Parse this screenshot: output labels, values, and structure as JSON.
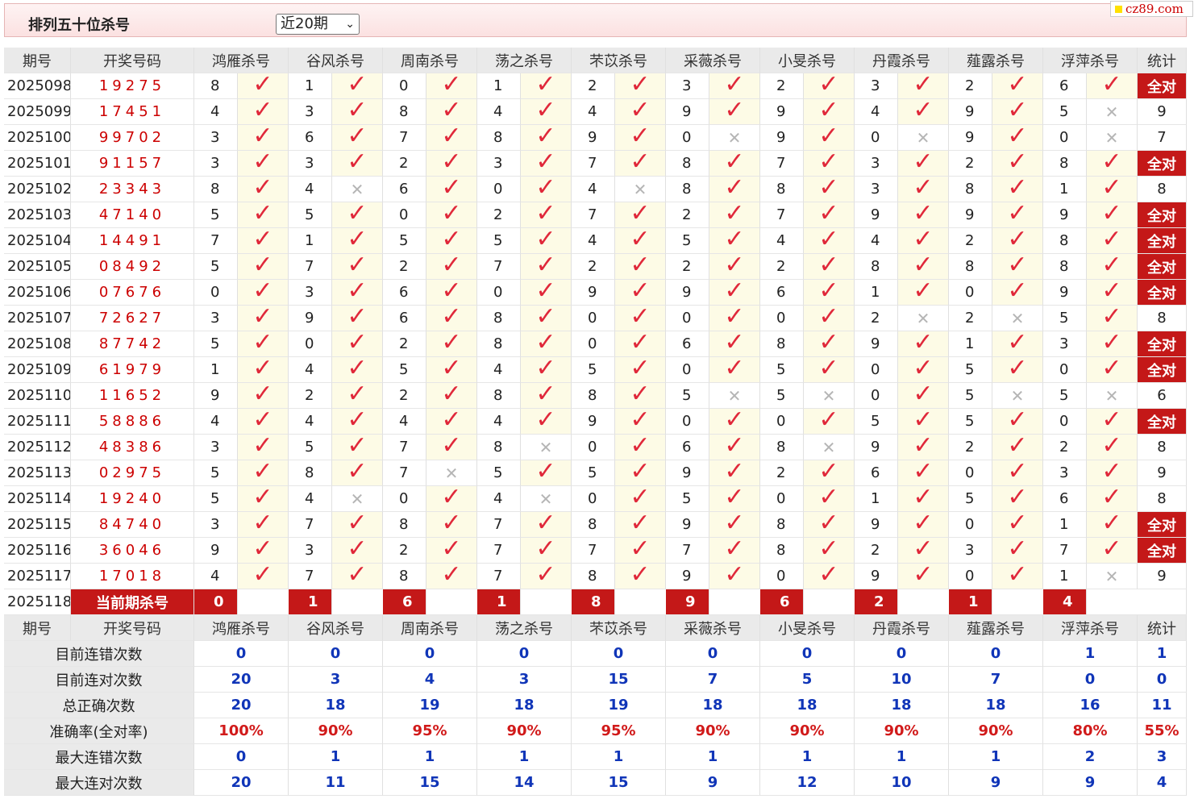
{
  "header": {
    "title": "排列五十位杀号",
    "period_select": "近20期",
    "logo_text": "cz89.com"
  },
  "columns": [
    "期号",
    "开奖号码",
    "鸿雁杀号",
    "谷风杀号",
    "周南杀号",
    "荡之杀号",
    "芣苡杀号",
    "采薇杀号",
    "小旻杀号",
    "丹霞杀号",
    "薤露杀号",
    "浮萍杀号",
    "统计"
  ],
  "rows": [
    {
      "issue": "2025098",
      "draw": "19275",
      "k": [
        "8",
        "1",
        "0",
        "1",
        "2",
        "3",
        "2",
        "3",
        "2",
        "6"
      ],
      "ok": [
        1,
        1,
        1,
        1,
        1,
        1,
        1,
        1,
        1,
        1
      ],
      "stat": "全对"
    },
    {
      "issue": "2025099",
      "draw": "17451",
      "k": [
        "4",
        "3",
        "8",
        "4",
        "4",
        "9",
        "9",
        "4",
        "9",
        "5"
      ],
      "ok": [
        1,
        1,
        1,
        1,
        1,
        1,
        1,
        1,
        1,
        0
      ],
      "stat": "9"
    },
    {
      "issue": "2025100",
      "draw": "99702",
      "k": [
        "3",
        "6",
        "7",
        "8",
        "9",
        "0",
        "9",
        "0",
        "9",
        "0"
      ],
      "ok": [
        1,
        1,
        1,
        1,
        1,
        0,
        1,
        0,
        1,
        0
      ],
      "stat": "7"
    },
    {
      "issue": "2025101",
      "draw": "91157",
      "k": [
        "3",
        "3",
        "2",
        "3",
        "7",
        "8",
        "7",
        "3",
        "2",
        "8"
      ],
      "ok": [
        1,
        1,
        1,
        1,
        1,
        1,
        1,
        1,
        1,
        1
      ],
      "stat": "全对"
    },
    {
      "issue": "2025102",
      "draw": "23343",
      "k": [
        "8",
        "4",
        "6",
        "0",
        "4",
        "8",
        "8",
        "3",
        "8",
        "1"
      ],
      "ok": [
        1,
        0,
        1,
        1,
        0,
        1,
        1,
        1,
        1,
        1
      ],
      "stat": "8"
    },
    {
      "issue": "2025103",
      "draw": "47140",
      "k": [
        "5",
        "5",
        "0",
        "2",
        "7",
        "2",
        "7",
        "9",
        "9",
        "9"
      ],
      "ok": [
        1,
        1,
        1,
        1,
        1,
        1,
        1,
        1,
        1,
        1
      ],
      "stat": "全对"
    },
    {
      "issue": "2025104",
      "draw": "14491",
      "k": [
        "7",
        "1",
        "5",
        "5",
        "4",
        "5",
        "4",
        "4",
        "2",
        "8"
      ],
      "ok": [
        1,
        1,
        1,
        1,
        1,
        1,
        1,
        1,
        1,
        1
      ],
      "stat": "全对"
    },
    {
      "issue": "2025105",
      "draw": "08492",
      "k": [
        "5",
        "7",
        "2",
        "7",
        "2",
        "2",
        "2",
        "8",
        "8",
        "8"
      ],
      "ok": [
        1,
        1,
        1,
        1,
        1,
        1,
        1,
        1,
        1,
        1
      ],
      "stat": "全对"
    },
    {
      "issue": "2025106",
      "draw": "07676",
      "k": [
        "0",
        "3",
        "6",
        "0",
        "9",
        "9",
        "6",
        "1",
        "0",
        "9"
      ],
      "ok": [
        1,
        1,
        1,
        1,
        1,
        1,
        1,
        1,
        1,
        1
      ],
      "stat": "全对"
    },
    {
      "issue": "2025107",
      "draw": "72627",
      "k": [
        "3",
        "9",
        "6",
        "8",
        "0",
        "0",
        "0",
        "2",
        "2",
        "5"
      ],
      "ok": [
        1,
        1,
        1,
        1,
        1,
        1,
        1,
        0,
        0,
        1
      ],
      "stat": "8"
    },
    {
      "issue": "2025108",
      "draw": "87742",
      "k": [
        "5",
        "0",
        "2",
        "8",
        "0",
        "6",
        "8",
        "9",
        "1",
        "3"
      ],
      "ok": [
        1,
        1,
        1,
        1,
        1,
        1,
        1,
        1,
        1,
        1
      ],
      "stat": "全对"
    },
    {
      "issue": "2025109",
      "draw": "61979",
      "k": [
        "1",
        "4",
        "5",
        "4",
        "5",
        "0",
        "5",
        "0",
        "5",
        "0"
      ],
      "ok": [
        1,
        1,
        1,
        1,
        1,
        1,
        1,
        1,
        1,
        1
      ],
      "stat": "全对"
    },
    {
      "issue": "2025110",
      "draw": "11652",
      "k": [
        "9",
        "2",
        "2",
        "8",
        "8",
        "5",
        "5",
        "0",
        "5",
        "5"
      ],
      "ok": [
        1,
        1,
        1,
        1,
        1,
        0,
        0,
        1,
        0,
        0
      ],
      "stat": "6"
    },
    {
      "issue": "2025111",
      "draw": "58886",
      "k": [
        "4",
        "4",
        "4",
        "4",
        "9",
        "0",
        "0",
        "5",
        "5",
        "0"
      ],
      "ok": [
        1,
        1,
        1,
        1,
        1,
        1,
        1,
        1,
        1,
        1
      ],
      "stat": "全对"
    },
    {
      "issue": "2025112",
      "draw": "48386",
      "k": [
        "3",
        "5",
        "7",
        "8",
        "0",
        "6",
        "8",
        "9",
        "2",
        "2"
      ],
      "ok": [
        1,
        1,
        1,
        0,
        1,
        1,
        0,
        1,
        1,
        1
      ],
      "stat": "8"
    },
    {
      "issue": "2025113",
      "draw": "02975",
      "k": [
        "5",
        "8",
        "7",
        "5",
        "5",
        "9",
        "2",
        "6",
        "0",
        "3"
      ],
      "ok": [
        1,
        1,
        0,
        1,
        1,
        1,
        1,
        1,
        1,
        1
      ],
      "stat": "9"
    },
    {
      "issue": "2025114",
      "draw": "19240",
      "k": [
        "5",
        "4",
        "0",
        "4",
        "0",
        "5",
        "0",
        "1",
        "5",
        "6"
      ],
      "ok": [
        1,
        0,
        1,
        0,
        1,
        1,
        1,
        1,
        1,
        1
      ],
      "stat": "8"
    },
    {
      "issue": "2025115",
      "draw": "84740",
      "k": [
        "3",
        "7",
        "8",
        "7",
        "8",
        "9",
        "8",
        "9",
        "0",
        "1"
      ],
      "ok": [
        1,
        1,
        1,
        1,
        1,
        1,
        1,
        1,
        1,
        1
      ],
      "stat": "全对"
    },
    {
      "issue": "2025116",
      "draw": "36046",
      "k": [
        "9",
        "3",
        "2",
        "7",
        "7",
        "7",
        "8",
        "2",
        "3",
        "7"
      ],
      "ok": [
        1,
        1,
        1,
        1,
        1,
        1,
        1,
        1,
        1,
        1
      ],
      "stat": "全对"
    },
    {
      "issue": "2025117",
      "draw": "17018",
      "k": [
        "4",
        "7",
        "8",
        "7",
        "8",
        "9",
        "0",
        "9",
        "0",
        "1"
      ],
      "ok": [
        1,
        1,
        1,
        1,
        1,
        1,
        1,
        1,
        1,
        0
      ],
      "stat": "9"
    }
  ],
  "current": {
    "issue": "2025118",
    "label": "当前期杀号",
    "k": [
      "0",
      "1",
      "6",
      "1",
      "8",
      "9",
      "6",
      "2",
      "1",
      "4"
    ]
  },
  "stats": [
    {
      "label": "目前连错次数",
      "vals": [
        "0",
        "0",
        "0",
        "0",
        "0",
        "0",
        "0",
        "0",
        "0",
        "1",
        "1"
      ],
      "color": "blue"
    },
    {
      "label": "目前连对次数",
      "vals": [
        "20",
        "3",
        "4",
        "3",
        "15",
        "7",
        "5",
        "10",
        "7",
        "0",
        "0"
      ],
      "color": "blue"
    },
    {
      "label": "总正确次数",
      "vals": [
        "20",
        "18",
        "19",
        "18",
        "19",
        "18",
        "18",
        "18",
        "18",
        "16",
        "11"
      ],
      "color": "blue"
    },
    {
      "label": "准确率(全对率)",
      "vals": [
        "100%",
        "90%",
        "95%",
        "90%",
        "95%",
        "90%",
        "90%",
        "90%",
        "90%",
        "80%",
        "55%"
      ],
      "color": "red"
    },
    {
      "label": "最大连错次数",
      "vals": [
        "0",
        "1",
        "1",
        "1",
        "1",
        "1",
        "1",
        "1",
        "1",
        "2",
        "3"
      ],
      "color": "blue"
    },
    {
      "label": "最大连对次数",
      "vals": [
        "20",
        "11",
        "15",
        "14",
        "15",
        "9",
        "12",
        "10",
        "9",
        "9",
        "4"
      ],
      "color": "blue"
    }
  ],
  "icons": {
    "ok": "check-icon",
    "bad": "cross-icon"
  },
  "colors": {
    "accent": "#c41818",
    "check": "#e0283a",
    "stat_blue": "#1035b8",
    "stat_red": "#d11a1a"
  }
}
